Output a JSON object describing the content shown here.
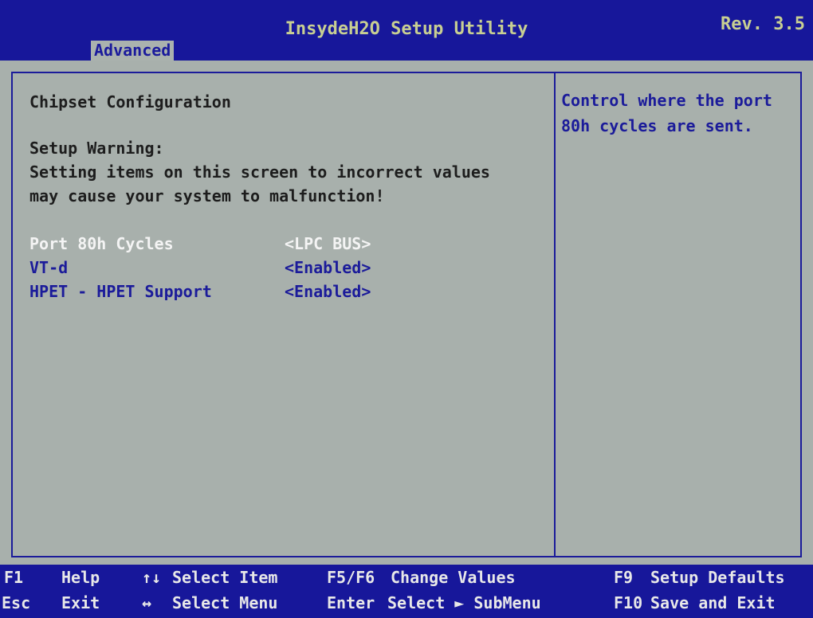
{
  "header": {
    "title": "InsydeH2O Setup Utility",
    "revision": "Rev. 3.5",
    "active_tab": "Advanced"
  },
  "content": {
    "section_title": "Chipset Configuration",
    "warning_title": "Setup Warning:",
    "warning_line1": "Setting items on this screen to incorrect values",
    "warning_line2": "may cause your system to malfunction!",
    "options": [
      {
        "label": "Port 80h Cycles",
        "value": "<LPC BUS>"
      },
      {
        "label": "VT-d",
        "value": "<Enabled>"
      },
      {
        "label": "HPET - HPET Support",
        "value": "<Enabled>"
      }
    ]
  },
  "help": {
    "text": "Control where the port\n80h cycles are sent."
  },
  "footer": {
    "f1_key": "F1",
    "f1_desc": "Help",
    "updown_key": "↑↓",
    "updown_desc": "Select Item",
    "f5f6_key": "F5/F6",
    "f5f6_desc": "Change Values",
    "f9_key": "F9",
    "f9_desc": "Setup Defaults",
    "esc_key": "Esc",
    "esc_desc": "Exit",
    "leftright_key": "↔",
    "leftright_desc": "Select Menu",
    "enter_key": "Enter",
    "enter_desc": "Select ► SubMenu",
    "f10_key": "F10",
    "f10_desc": "Save and Exit"
  },
  "colors": {
    "background": "#a8b0ac",
    "bar": "#17179a",
    "title_text": "#c8cf92",
    "selected_text": "#f4f4f4",
    "option_text": "#1b1b9a"
  }
}
